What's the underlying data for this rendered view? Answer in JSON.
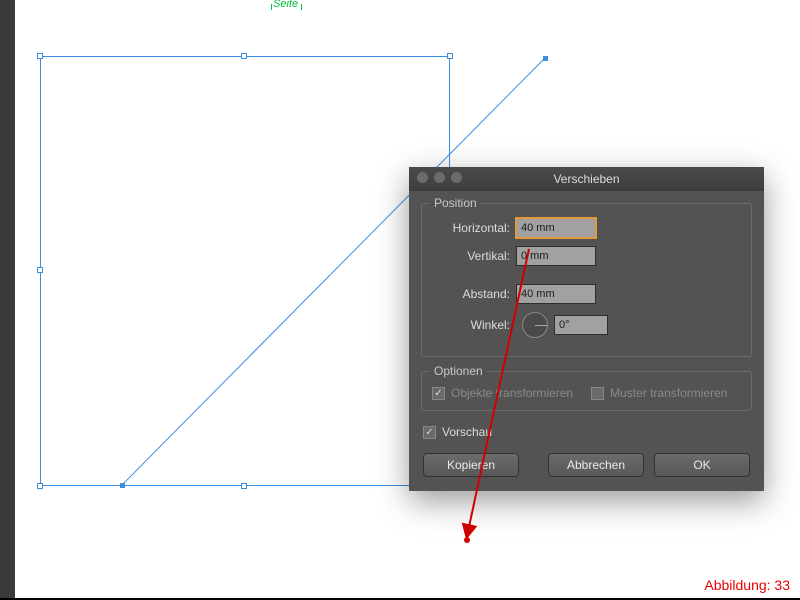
{
  "ruler": {
    "label": "Seite"
  },
  "dialog": {
    "title": "Verschieben",
    "position": {
      "group_label": "Position",
      "horizontal_label": "Horizontal:",
      "horizontal_value": "40 mm",
      "vertical_label": "Vertikal:",
      "vertical_value": "0 mm",
      "distance_label": "Abstand:",
      "distance_value": "40 mm",
      "angle_label": "Winkel:",
      "angle_value": "0°"
    },
    "options": {
      "group_label": "Optionen",
      "transform_objects_label": "Objekte transformieren",
      "transform_objects_checked": true,
      "transform_patterns_label": "Muster transformieren",
      "transform_patterns_checked": false
    },
    "preview": {
      "label": "Vorschau",
      "checked": true
    },
    "buttons": {
      "copy": "Kopieren",
      "cancel": "Abbrechen",
      "ok": "OK"
    }
  },
  "caption": "Abbildung: 33"
}
